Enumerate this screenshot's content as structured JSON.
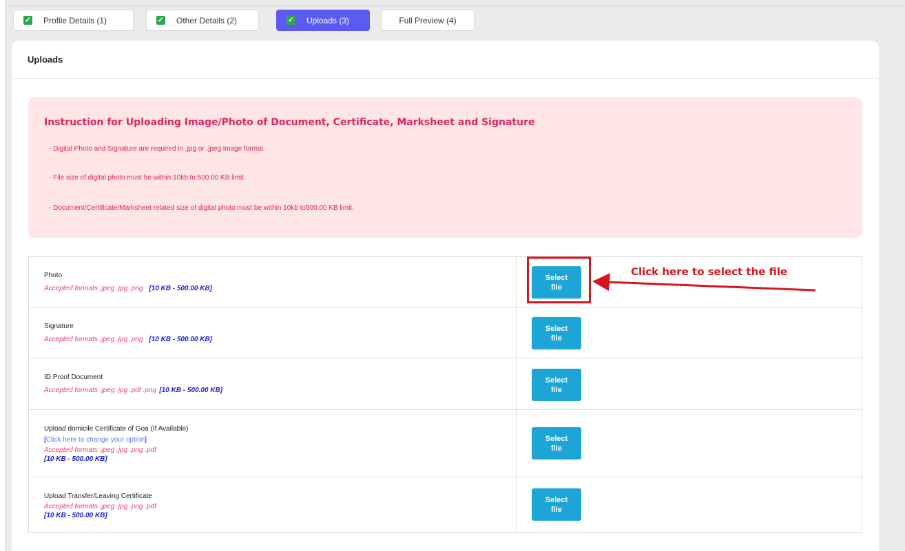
{
  "tabs": [
    {
      "label": "Profile Details",
      "num": "(1)",
      "checked": true
    },
    {
      "label": "Other Details",
      "num": "(2)",
      "checked": true
    },
    {
      "label": "Uploads",
      "num": "(3)",
      "checked": true,
      "active": true
    },
    {
      "label": "Full Preview",
      "num": "(4)",
      "checked": false
    }
  ],
  "card": {
    "title": "Uploads"
  },
  "instructions": {
    "title": "Instruction for Uploading Image/Photo of Document, Certificate, Marksheet and Signature",
    "lines": [
      "- Digital Photo and Signature are required in .jpg or .jpeg image format",
      "- File size of digital photo must be within 10kb to 500.00 KB limit.",
      "- Document/Certificate/Marksheet related size of digital photo must be within 10kb to500.00 KB limit."
    ]
  },
  "uploads": [
    {
      "name": "Photo",
      "formats": "Accepted formats .jpeg .jpg .png",
      "size": "[10 KB - 500.00 KB]",
      "button": "Select file"
    },
    {
      "name": "Signature",
      "formats": "Accepted formats .jpeg .jpg .png",
      "size": "[10 KB - 500.00 KB]",
      "button": "Select file"
    },
    {
      "name": "ID Proof Document",
      "formats": "Accepted formats .jpeg .jpg .pdf .png",
      "size": "[10 KB - 500.00 KB]",
      "button": "Select file"
    },
    {
      "name": "Upload domicile Certificate of Goa (If Available)",
      "link_open": "[",
      "link": "Click here to change your option",
      "link_close": "]",
      "formats": "Accepted formats .jpeg .jpg .png .pdf",
      "size": "[10 KB - 500.00 KB]",
      "button": "Select file"
    },
    {
      "name": "Upload Transfer/Leaving Certificate",
      "formats": "Accepted formats .jpeg .jpg .png .pdf",
      "size": "[10 KB - 500.00 KB]",
      "button": "Select file"
    }
  ],
  "annotation": {
    "callout": "Click here to select the file",
    "color": "#d8141c"
  },
  "colors": {
    "active_tab": "#5b5bf2",
    "button": "#1ea5d8",
    "check": "#2ea84f",
    "instruction_bg": "#ffe6e6",
    "instruction_text": "#e0245e"
  }
}
